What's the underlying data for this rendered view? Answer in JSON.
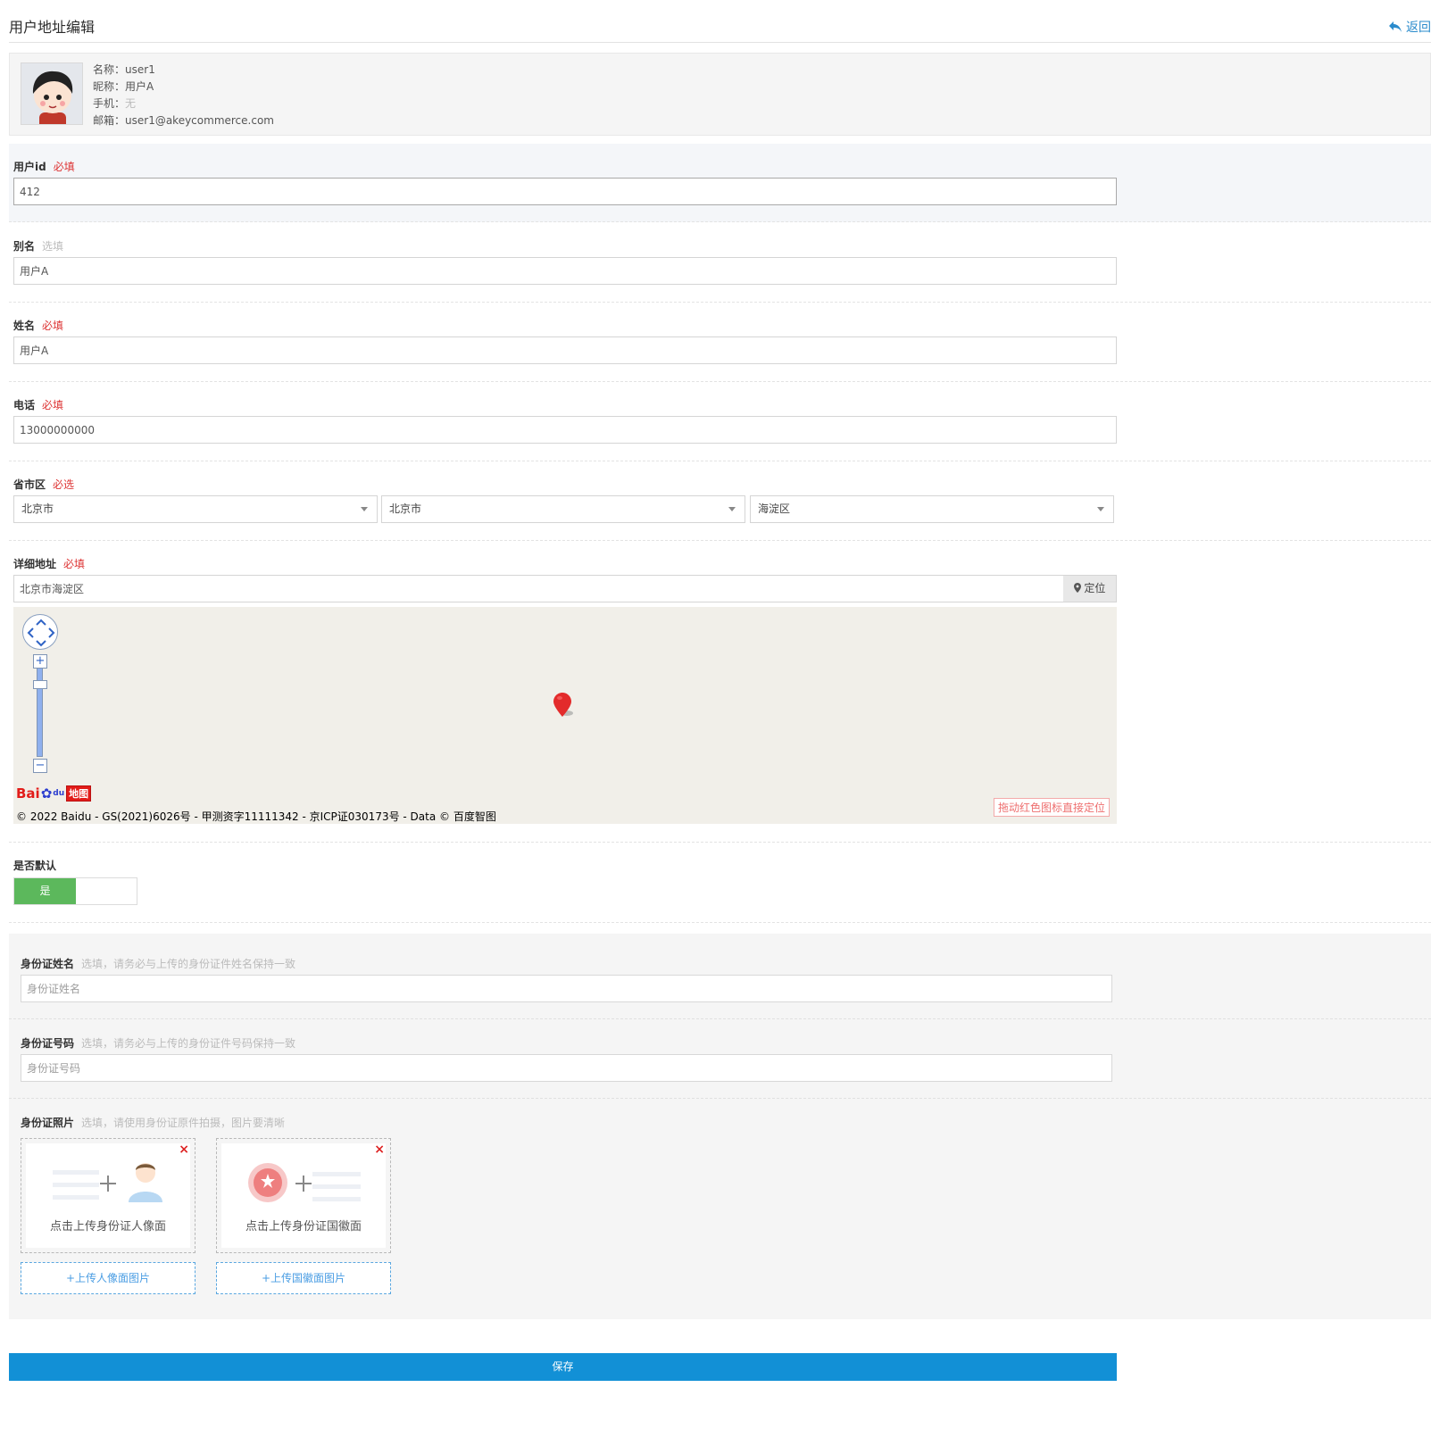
{
  "header": {
    "title": "用户地址编辑",
    "back_label": "返回"
  },
  "profile": {
    "name_label": "名称：",
    "name_value": "user1",
    "nick_label": "昵称：",
    "nick_value": "用户A",
    "phone_label": "手机：",
    "phone_value": "无",
    "email_label": "邮箱：",
    "email_value": "user1@akeycommerce.com"
  },
  "fields": {
    "user_id": {
      "label": "用户id",
      "tag": "必填",
      "value": "412"
    },
    "alias": {
      "label": "别名",
      "tag": "选填",
      "value": "用户A"
    },
    "name": {
      "label": "姓名",
      "tag": "必填",
      "value": "用户A"
    },
    "phone": {
      "label": "电话",
      "tag": "必填",
      "value": "13000000000"
    },
    "region": {
      "label": "省市区",
      "tag": "必选",
      "province": "北京市",
      "city": "北京市",
      "district": "海淀区"
    },
    "address": {
      "label": "详细地址",
      "tag": "必填",
      "value": "北京市海淀区",
      "locate_label": "定位"
    },
    "default": {
      "label": "是否默认",
      "on_label": "是",
      "value": true
    }
  },
  "map": {
    "logo_bai": "Bai",
    "logo_du": "du",
    "logo_ditu": "地图",
    "copyright": "© 2022 Baidu - GS(2021)6026号 - 甲测资字11111342 - 京ICP证030173号 - Data © 百度智图",
    "hint": "拖动红色图标直接定位"
  },
  "idcard": {
    "name": {
      "label": "身份证姓名",
      "hint": "选填，请务必与上传的身份证件姓名保持一致",
      "placeholder": "身份证姓名"
    },
    "number": {
      "label": "身份证号码",
      "hint": "选填，请务必与上传的身份证件号码保持一致",
      "placeholder": "身份证号码"
    },
    "photo": {
      "label": "身份证照片",
      "hint": "选填，请使用身份证原件拍摄，图片要清晰"
    },
    "front": {
      "caption": "点击上传身份证人像面",
      "button": "+上传人像面图片"
    },
    "back": {
      "caption": "点击上传身份证国徽面",
      "button": "+上传国徽面图片"
    }
  },
  "actions": {
    "save_label": "保存"
  },
  "colors": {
    "primary": "#1290d6",
    "required": "#dd3333",
    "toggle_on": "#5cb85c",
    "link": "#2a8bcc"
  }
}
